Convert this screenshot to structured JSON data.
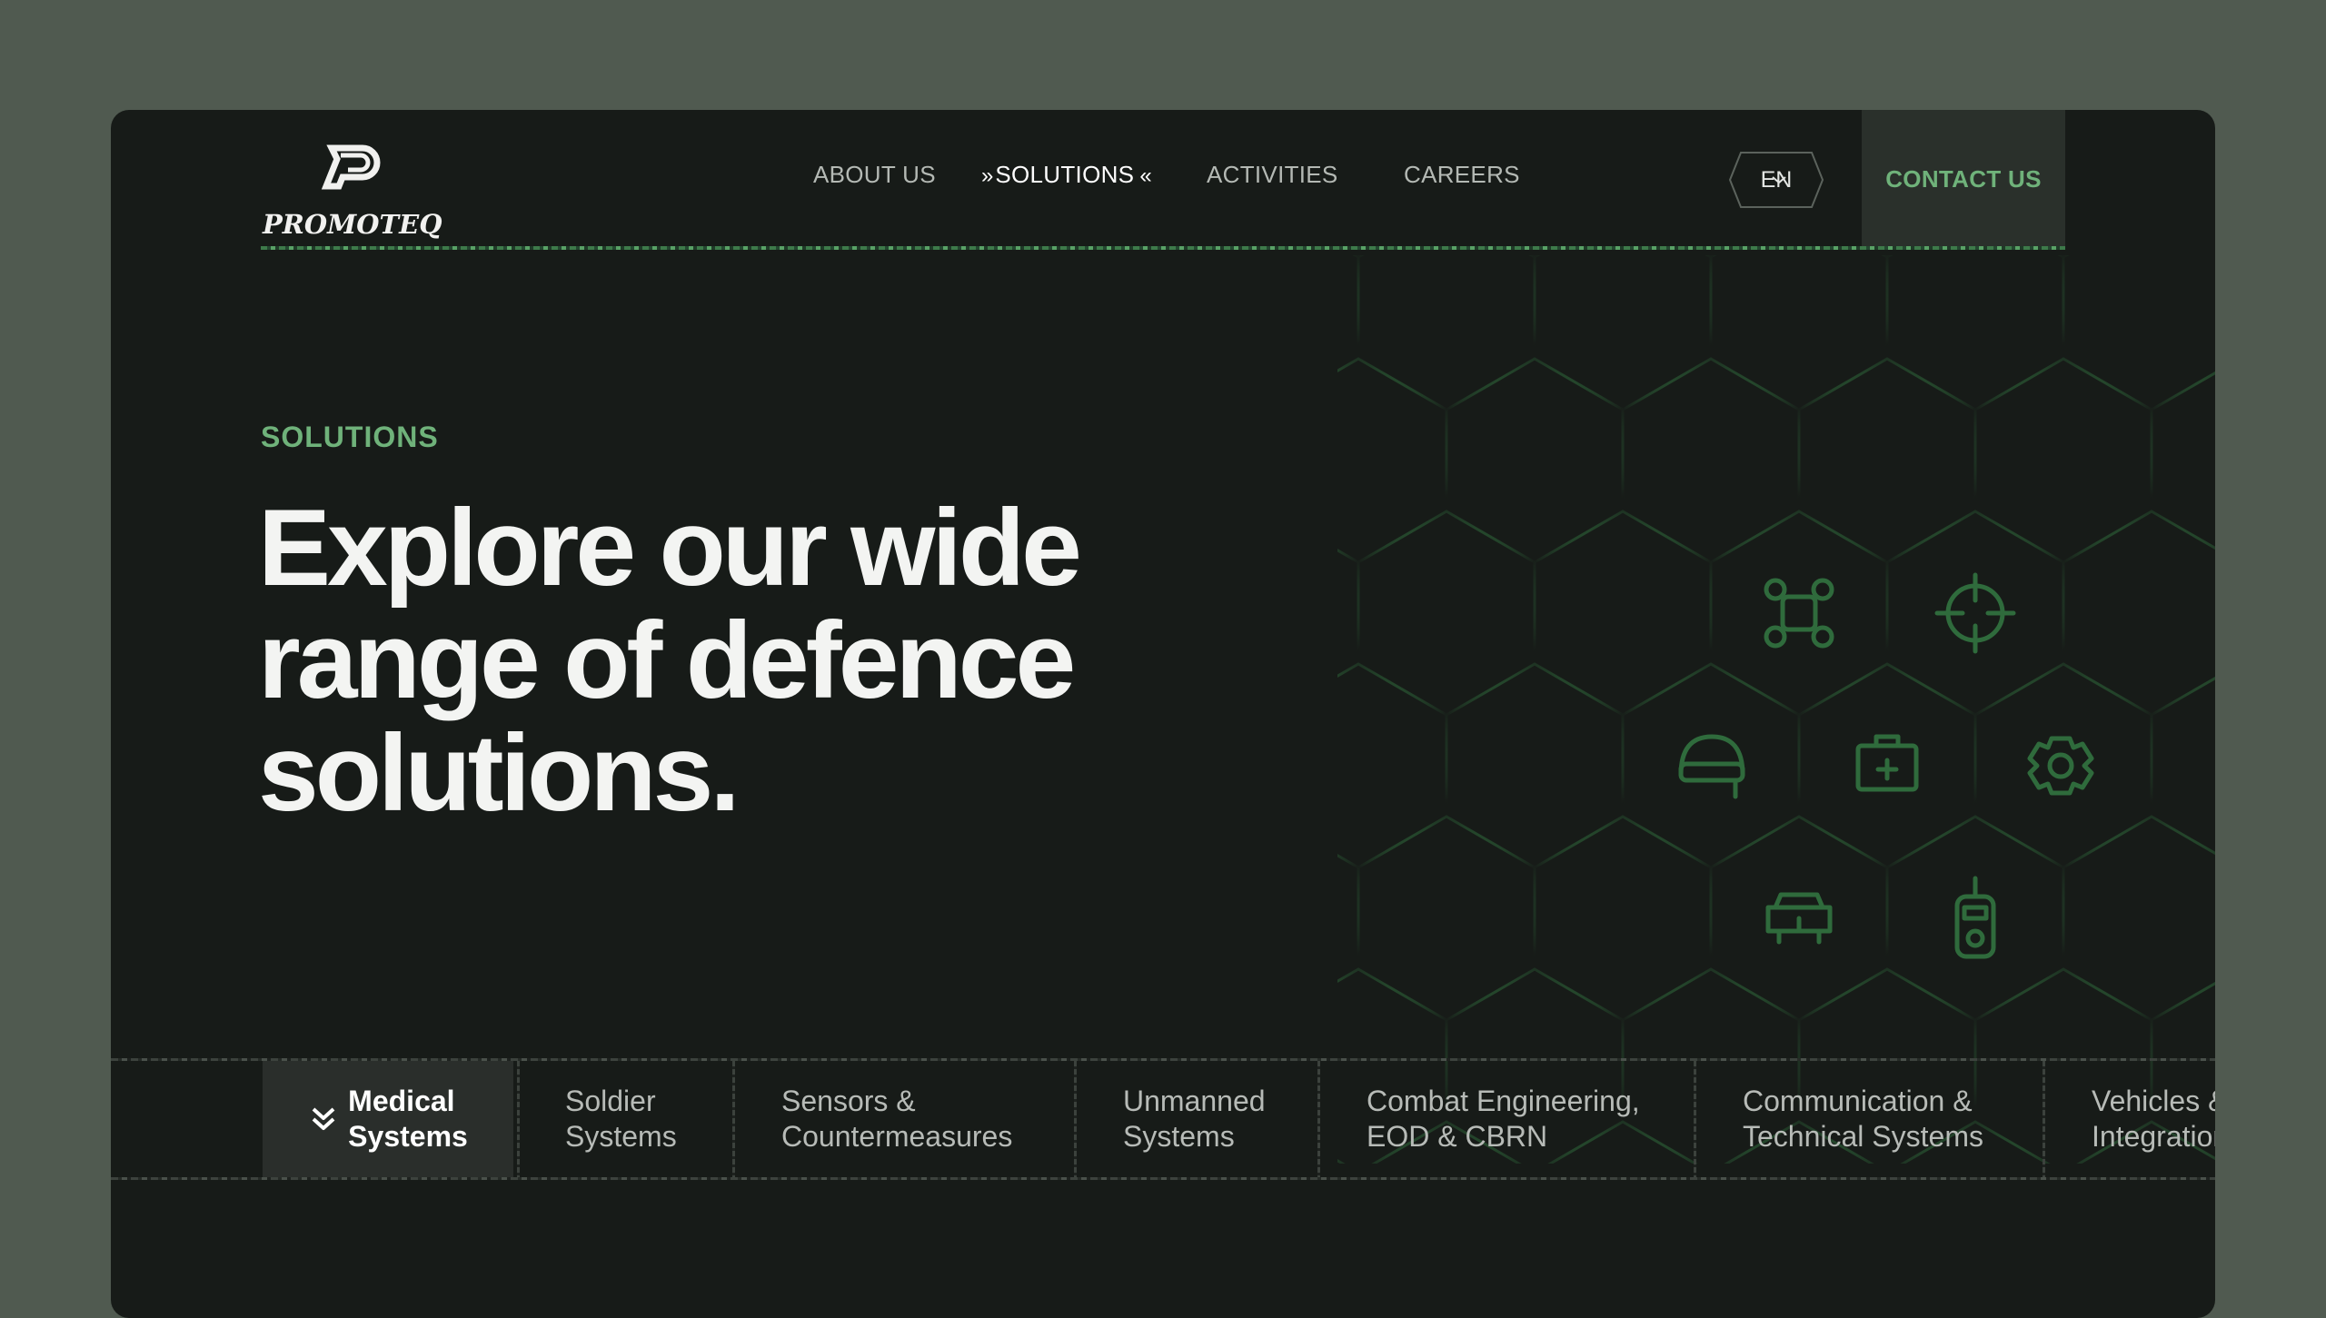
{
  "brand": {
    "name": "PROMOTEQ"
  },
  "nav": {
    "about": "ABOUT US",
    "solutions": "SOLUTIONS",
    "activities": "ACTIVITIES",
    "careers": "CAREERS",
    "language": "EN",
    "contact": "CONTACT US"
  },
  "hero": {
    "eyebrow": "SOLUTIONS",
    "line1": "Explore our wide",
    "line2": "range of defence",
    "line3": "solutions."
  },
  "tabs": [
    {
      "label": "Medical\nSystems",
      "active": true
    },
    {
      "label": "Soldier\nSystems"
    },
    {
      "label": "Sensors &\nCountermeasures"
    },
    {
      "label": "Unmanned\nSystems"
    },
    {
      "label": "Combat Engineering,\nEOD & CBRN"
    },
    {
      "label": "Communication &\nTechnical Systems"
    },
    {
      "label": "Vehicles &\nIntegration"
    }
  ],
  "colors": {
    "accent": "#6fb27a",
    "background": "#171b18",
    "outer": "#505a50",
    "hex_stroke": "#2f6b3c"
  },
  "hex_icons": [
    "drone-icon",
    "crosshair-icon",
    "helmet-icon",
    "medkit-icon",
    "gear-icon",
    "vehicle-icon",
    "radio-icon"
  ]
}
